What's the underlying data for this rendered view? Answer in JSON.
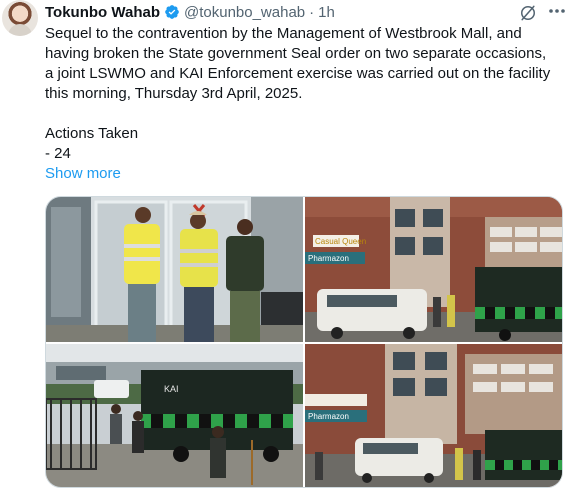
{
  "author": {
    "name": "Tokunbo Wahab",
    "handle": "@tokunbo_wahab",
    "separator": "·",
    "time": "1h"
  },
  "icons": {
    "verified": "verified-badge-icon",
    "grok": "grok-icon",
    "more": "more-options-icon"
  },
  "body": {
    "lines": [
      "Sequel to the contravention by the Management of Westbrook Mall, and",
      "having broken the State government Seal order on two separate occasions,",
      "a joint LSWMO and KAI Enforcement exercise was carried out on the facility",
      "this morning, Thursday 3rd April, 2025."
    ],
    "actions_heading": "Actions Taken",
    "actions_first": "- 24",
    "show_more": "Show more"
  },
  "media": {
    "photo2_signs": [
      "Pharmazon",
      "Casual Queen"
    ],
    "photo3_signs": [
      "KAI"
    ]
  },
  "colors": {
    "link": "#1d9bf0",
    "verified": "#1d9bf0",
    "secondary_text": "#536471"
  }
}
